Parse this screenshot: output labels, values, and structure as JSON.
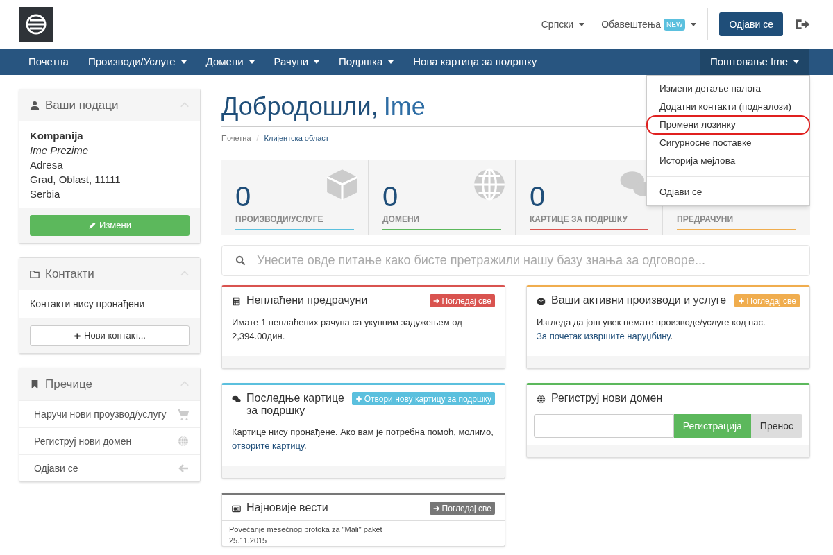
{
  "header": {
    "language": "Српски",
    "notifications": {
      "label": "Обавештења",
      "badge": "NEW"
    },
    "logout_button": "Одјави се"
  },
  "nav": {
    "items": [
      {
        "label": "Почетна",
        "caret": false
      },
      {
        "label": "Производи/Услуге",
        "caret": true
      },
      {
        "label": "Домени",
        "caret": true
      },
      {
        "label": "Рачуни",
        "caret": true
      },
      {
        "label": "Подршка",
        "caret": true
      },
      {
        "label": "Нова картица за подршку",
        "caret": false
      }
    ],
    "user_menu": {
      "label": "Поштовање Ime",
      "expanded": true,
      "items": [
        {
          "kind": "link",
          "label": "Измени детаље налога",
          "highlighted": false
        },
        {
          "kind": "link",
          "label": "Додатни контакти (подналози)",
          "highlighted": false
        },
        {
          "kind": "link",
          "label": "Промени лозинку",
          "highlighted": true
        },
        {
          "kind": "link",
          "label": "Сигурносне поставке",
          "highlighted": false
        },
        {
          "kind": "link",
          "label": "Историја мејлова",
          "highlighted": false
        },
        {
          "kind": "divider"
        },
        {
          "kind": "link",
          "label": "Одјави се",
          "highlighted": false
        }
      ]
    }
  },
  "sidebar": [
    {
      "kind": "details",
      "title": "Ваши подаци",
      "company": "Kompanija",
      "name": "Ime Prezime",
      "lines": [
        "Adresa",
        "Grad, Oblast, 11111",
        "Serbia"
      ],
      "button": "Измени"
    },
    {
      "kind": "contacts",
      "title": "Контакти",
      "text": "Контакти нису пронађени",
      "button": "Нови контакт..."
    },
    {
      "kind": "shortcuts",
      "title": "Пречице",
      "items": [
        "Наручи нови проузвод/услугу",
        "Региструј нови домен",
        "Одјави се"
      ]
    }
  ],
  "welcome": {
    "title": "Добродошли,",
    "name": "Ime"
  },
  "breadcrumb": {
    "separator": "/",
    "items": [
      {
        "label": "Почетна",
        "selected": false
      },
      {
        "label": "Клијентска област",
        "selected": true
      }
    ]
  },
  "stats": [
    {
      "count": "0",
      "label": "ПРОИЗВОДИ/УСЛУГЕ",
      "color": "#5bc0de"
    },
    {
      "count": "0",
      "label": "ДОМЕНИ",
      "color": "#5cb85c"
    },
    {
      "count": "0",
      "label": "КАРТИЦЕ ЗА ПОДРШКУ",
      "color": "#d9534f"
    },
    {
      "label": "ПРЕДРАЧУНИ",
      "color": "#f0ad4e"
    }
  ],
  "search": {
    "placeholder": "Унесите овде питање како бисте претражили нашу базу знања за одговоре..."
  },
  "panels": [
    {
      "kind": "text",
      "title": "Неплаћени предрачуни",
      "color": "#d9534f",
      "button": "Погледај све",
      "text": "Имате 1 неплаћених рачуна са укупним задужењем од 2,394.00дин."
    },
    {
      "kind": "text",
      "title": "Ваши активни производи и услуге",
      "color": "#f0ad4e",
      "button": "Погледај све",
      "text": "Изгледа да још увек немате производе/услуге код нас.",
      "link": "За почетак извршите наруџбину",
      "after": "."
    },
    {
      "kind": "text",
      "title": "Последње картице за подршку",
      "color": "#5bc0de",
      "button": "Отвори нову картицу за подршку",
      "text": "Картице нису пронађене. Ако вам је потребна помоћ, молимо,",
      "link": "отворите картицу",
      "after": "."
    },
    {
      "kind": "domain",
      "title": "Региструј нови домен",
      "color": "#5cb85c",
      "register": "Регистрација",
      "transfer": "Пренос"
    },
    {
      "kind": "news",
      "title": "Најновије вести",
      "color": "#777777",
      "button": "Погледај све",
      "news": [
        {
          "title": "Povećanje mesečnog protoka za \"Mali\" paket",
          "date": "25.11.2015"
        }
      ]
    }
  ]
}
